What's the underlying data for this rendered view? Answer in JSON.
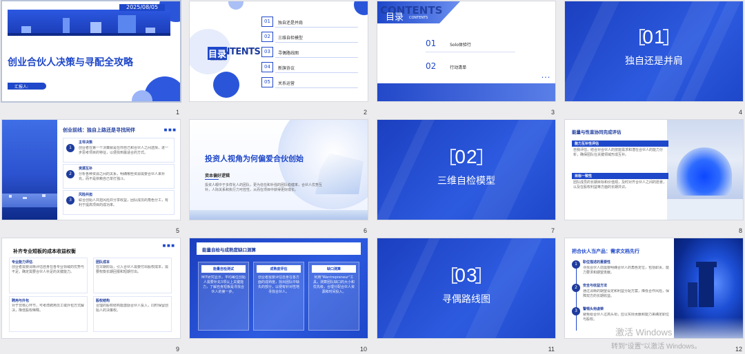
{
  "slides": [
    {
      "num": "1",
      "date": "2025/08/05",
      "title": "创业合伙人决策与寻配全攻略",
      "reporter": "汇报人:"
    },
    {
      "num": "2",
      "toc_title": "目录",
      "toc_bg": "CONTENTS",
      "toc_sub": "CONTENTS",
      "items": [
        {
          "n": "01",
          "label": "独自还是并肩"
        },
        {
          "n": "02",
          "label": "三维自检模型"
        },
        {
          "n": "03",
          "label": "寻偶路线图"
        },
        {
          "n": "04",
          "label": "新旗协议"
        },
        {
          "n": "05",
          "label": "关系运营"
        }
      ]
    },
    {
      "num": "3",
      "title_bg": "CONTENTS",
      "title": "目录",
      "sub": "CONTENTS",
      "items": [
        {
          "n": "01",
          "label": "Solo体验行"
        },
        {
          "n": "02",
          "label": "行动清单"
        }
      ]
    },
    {
      "num": "4",
      "sec": "01",
      "title": "独自还是并肩"
    },
    {
      "num": "5",
      "title": "创业前线：独自上路还是寻找同伴",
      "items": [
        {
          "n": "1",
          "h": "主导决策",
          "t": "创业者在第一个决策就是在你自己和合伙人之间选择，进一步思考项目的特征，以便找到最适合的方式。"
        },
        {
          "n": "2",
          "h": "资源互补",
          "t": "分析各种资源之间的关系，明确哪些资源需要合伙人来补充，而不是依赖自己单打独斗。"
        },
        {
          "n": "3",
          "h": "风险共担",
          "t": "联合创始人共担风险并分享收益，团队成员的角色分工，有利于提高项目的成功率。"
        }
      ]
    },
    {
      "num": "6",
      "title": "投资人视角为何偏爱合伙创始",
      "sub": "资本偏好逻辑",
      "text": "投资人眼中于多样化人的团队，更为信任和补强的团队稳健率，合伙人优势互补，人际关系和执行力可控性，从而在项目中获得更好成长。"
    },
    {
      "num": "7",
      "sec": "02",
      "title": "三维自检模型"
    },
    {
      "num": "8",
      "title": "能量与性直协同完成评估",
      "items": [
        {
          "h": "能力互补性评估",
          "t": "自我评估，结合对合伙人的技能需求和潜在合伙人的能力分析，确保团队在关键领域形成互补。"
        },
        {
          "h": "目标一致性",
          "t": "团队成员的长期目标和价值观，及时对齐合伙人之间的愿景，以及在股权利益等方面的长期共识。"
        }
      ]
    },
    {
      "num": "9",
      "title": "补齐专业短板的成本收益权衡",
      "items": [
        {
          "h": "专业能力评估",
          "t": "创业者需要清晰评估自身在各专业领域的优势与不足，确定需要合伙人补足的关键能力。"
        },
        {
          "h": "团队成本",
          "t": "在早期阶段，引入合伙人需要付出股权成本，需要权衡长期回报和短期付出。"
        },
        {
          "h": "聘用与外包",
          "t": "对于非核心环节，可考虑聘用员工或外包方式解决，降低股权稀释。"
        },
        {
          "h": "股权结构",
          "t": "合理的股权结构能激励合伙人投入，同时保留创始人的决策权。"
        }
      ]
    },
    {
      "num": "10",
      "title": "能量自检与成熟度缺口测算",
      "cols": [
        {
          "h": "能量自检测试",
          "t": "MIT研究显示，平均每位创始人需要补充3项以上关键能力，了解自身短板是寻找合伙人的第一步。"
        },
        {
          "h": "成熟度评估",
          "t": "创业者需要评估自身在各方面的成熟度，找出团队中缺失的部分，以便有针对性地寻找合伙人。"
        },
        {
          "h": "缺口测算",
          "t": "利用\"Wantrepreneur\"工具，测算团队缺口的大小和优先级，合理分配合伙人资源和时间投入。"
        }
      ]
    },
    {
      "num": "11",
      "sec": "03",
      "title": "寻偶路线图"
    },
    {
      "num": "12",
      "title": "把合伙人当产品：需求文档先行",
      "items": [
        {
          "n": "1",
          "h": "职位描述的重要性",
          "t": "寻找合伙人前需要明确合伙人的角色定位，包括职责、能力要求和期望贡献。"
        },
        {
          "n": "2",
          "h": "安全与收益方法",
          "t": "通过清晰的期望设定和利益分配方案，降低合作风险，保障双方的长期收益。"
        },
        {
          "n": "3",
          "h": "警惕头衔虚荣",
          "t": "避免给合伙人过高头衔，应以实际贡献和能力来确定职位与股权。"
        }
      ]
    }
  ],
  "watermark": {
    "line1": "激活 Windows",
    "line2": "转到\"设置\"以激活 Windows。"
  },
  "colors": {
    "primary": "#1e47c9",
    "dark": "#1e3c9e",
    "accent": "#3d66e6"
  }
}
